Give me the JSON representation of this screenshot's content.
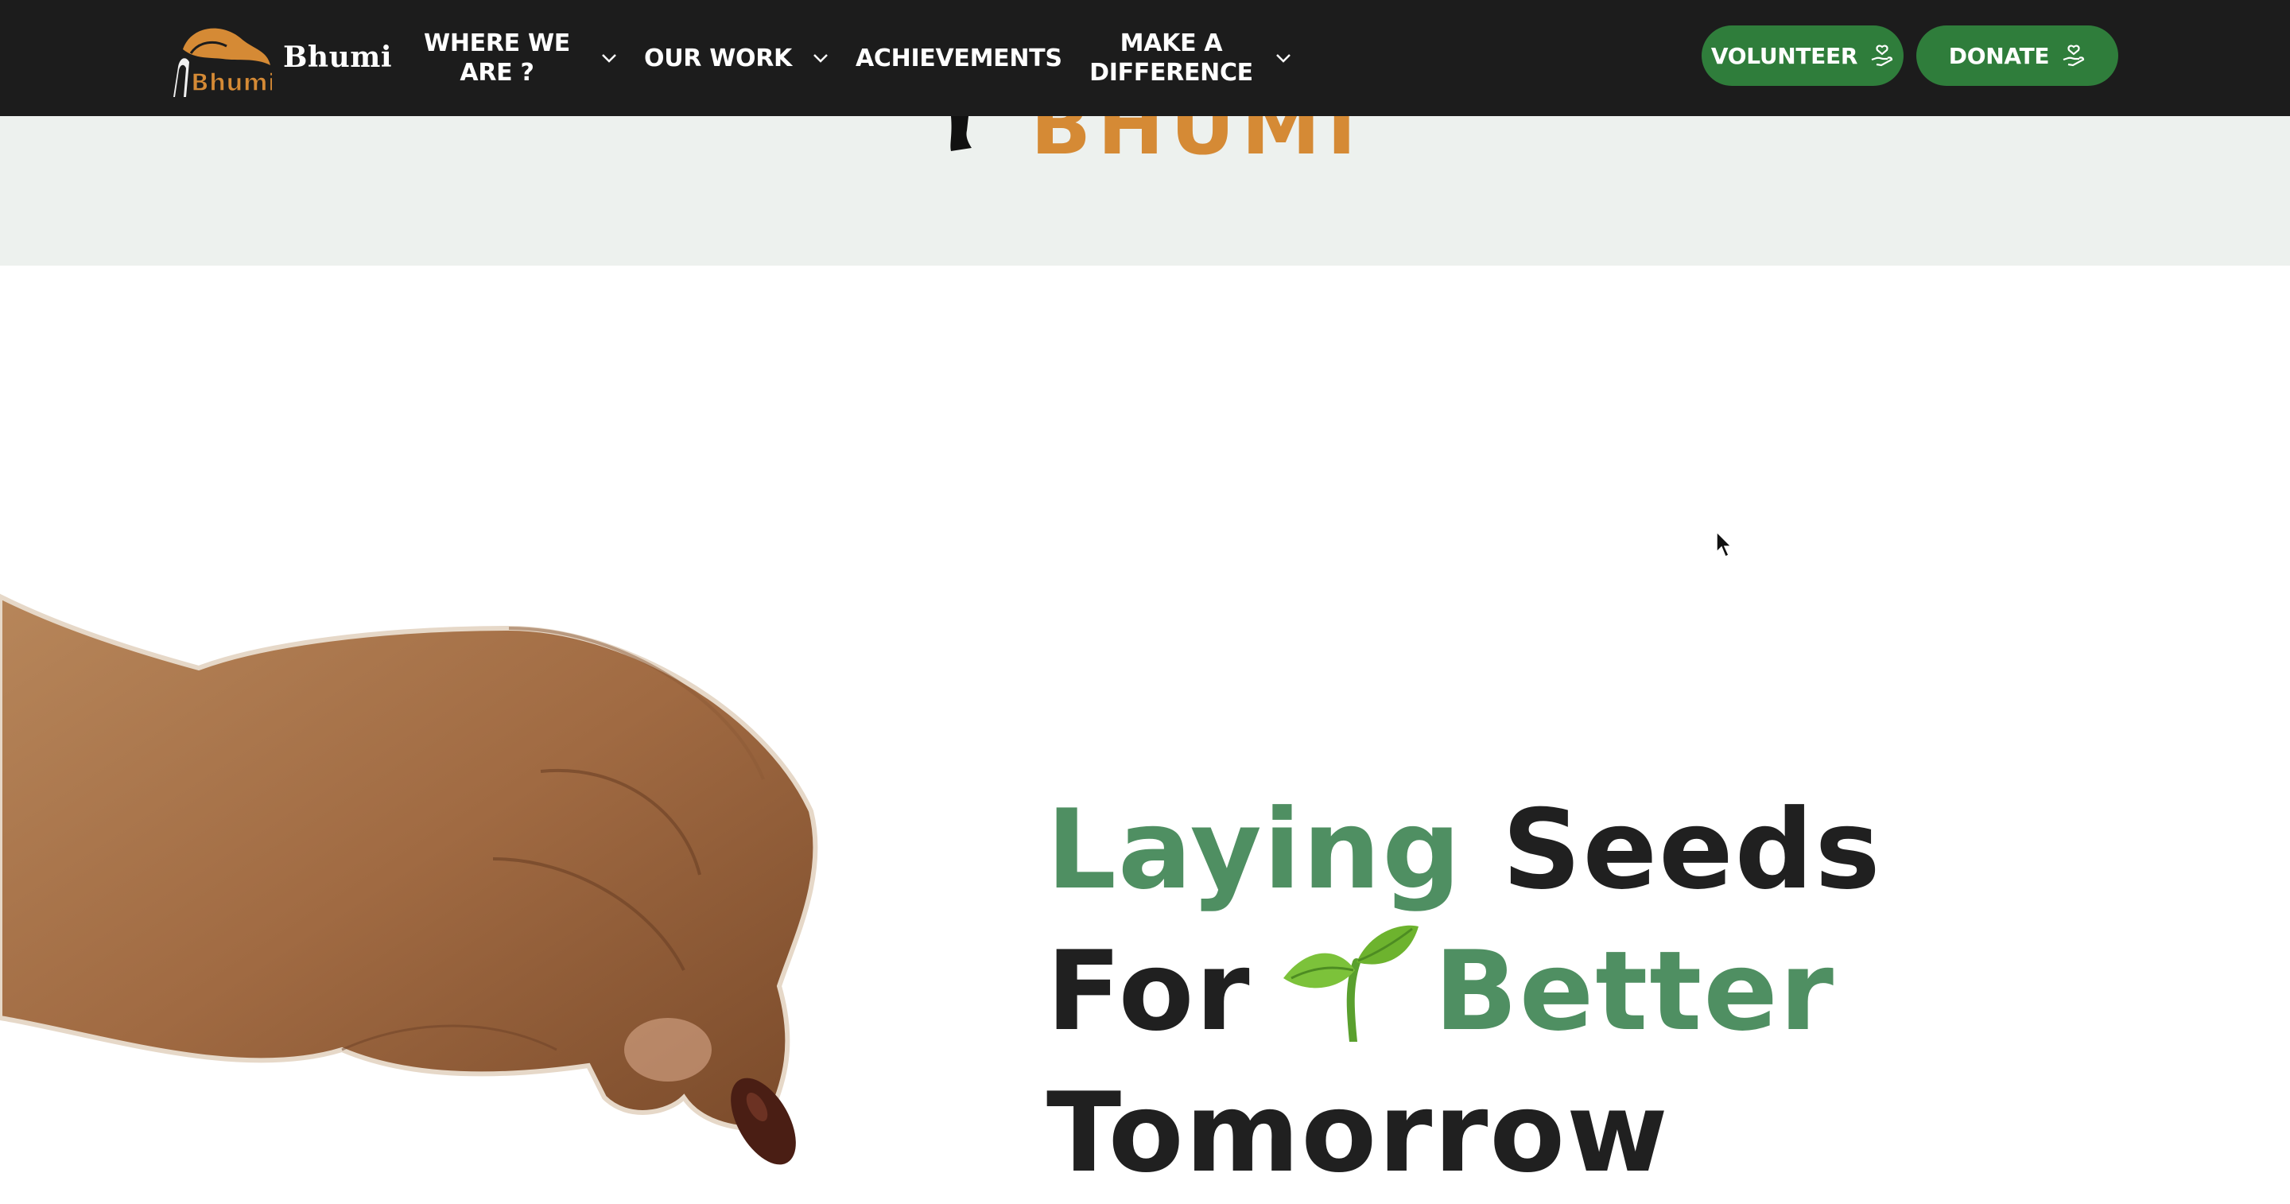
{
  "brand": {
    "name": "Bhumi",
    "logo_text": "Bhumi"
  },
  "nav": {
    "items": [
      {
        "label": "WHERE WE ARE ?",
        "has_dropdown": true
      },
      {
        "label": "OUR WORK",
        "has_dropdown": true
      },
      {
        "label": "ACHIEVEMENTS",
        "has_dropdown": false
      },
      {
        "label": "MAKE A DIFFERENCE",
        "has_dropdown": true
      }
    ],
    "volunteer_label": "VOLUNTEER",
    "donate_label": "DONATE"
  },
  "hero": {
    "strip_word": "BHUMI"
  },
  "headline": {
    "word1": "Laying",
    "word2": "Seeds",
    "word3": "For",
    "word4": "Better",
    "word5": "Tomorrow"
  },
  "colors": {
    "nav_bg": "#1c1c1c",
    "button_green": "#2f7d3b",
    "headline_green": "#4f8f62",
    "brand_orange": "#d58a35",
    "strip_bg": "#edf1ee"
  },
  "icons": [
    "sprout-icon",
    "hand-heart-icon",
    "chevron-down-icon"
  ]
}
